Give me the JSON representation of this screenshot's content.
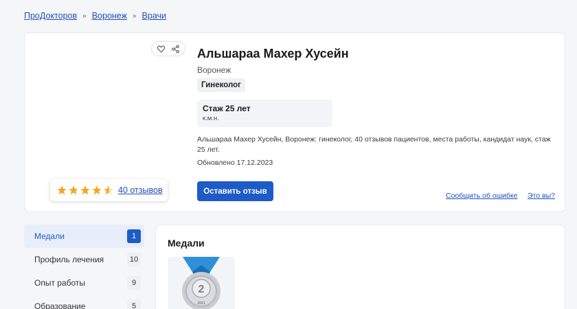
{
  "breadcrumb": {
    "items": [
      "ПроДокторов",
      "Воронеж",
      "Врачи"
    ],
    "separator": "»"
  },
  "doctor": {
    "name": "Альшараа Махер Хусейн",
    "city": "Воронеж",
    "specialty": "Гинеколог",
    "experience": "Стаж 25 лет",
    "degree": "к.м.н.",
    "description": "Альшараа Махер Хусейн, Воронеж: гинеколог, 40 отзывов пациентов, места работы, кандидат наук, стаж 25 лет.",
    "updated": "Обновлено 17.12.2023"
  },
  "rating": {
    "stars": 4.5,
    "max_stars": 5,
    "reviews_label": "40 отзывов",
    "star_color": "#f5a623"
  },
  "actions": {
    "review_button": "Оставить отзыв",
    "report_error": "Сообщить об ошибке",
    "whats_this": "Это вы?"
  },
  "icons": {
    "favorite": "heart-icon",
    "share": "share-icon"
  },
  "sidebar": {
    "items": [
      {
        "label": "Медали",
        "count": "1",
        "active": true
      },
      {
        "label": "Профиль лечения",
        "count": "10",
        "active": false
      },
      {
        "label": "Опыт работы",
        "count": "9",
        "active": false
      },
      {
        "label": "Образование",
        "count": "5",
        "active": false
      }
    ]
  },
  "main": {
    "title": "Медали",
    "medal": {
      "number": "2",
      "year": "2021"
    }
  },
  "colors": {
    "accent": "#1e5bc6",
    "link": "#1f4fb8",
    "active_bg": "#e8eef9"
  }
}
